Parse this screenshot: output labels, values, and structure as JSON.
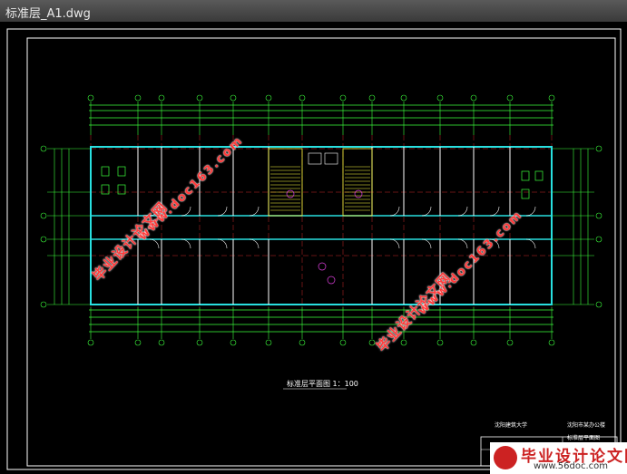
{
  "window": {
    "title": "标准层_A1.dwg"
  },
  "drawing": {
    "caption": "标准层平面图 1：100",
    "titleblock": {
      "school": "沈阳建筑大学",
      "project": "沈阳市某办公楼",
      "sheet": "标准层平面图"
    }
  },
  "watermarks": {
    "site_a": "毕业设计论文网",
    "url_a": "www.doc163.com",
    "site_b": "毕业设计论文网",
    "url_b": "www.doc163.com"
  },
  "logo": {
    "name": "毕业设计论文网",
    "url": "www.56doc.com"
  }
}
